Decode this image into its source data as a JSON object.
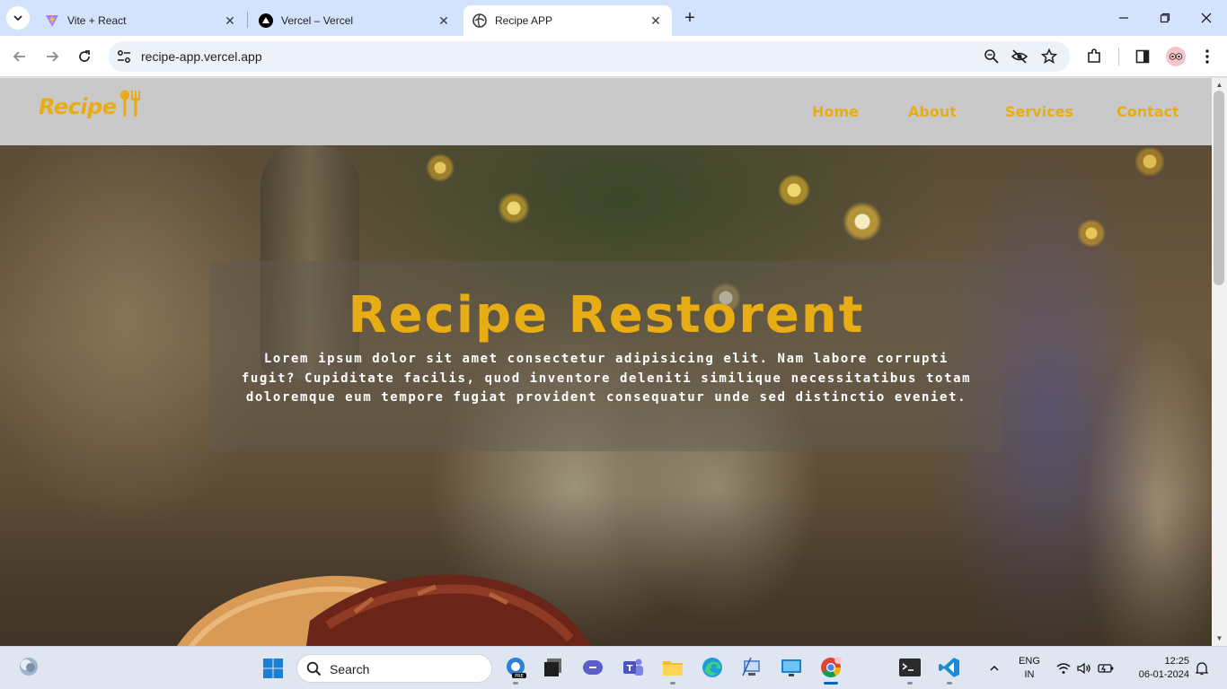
{
  "browser": {
    "tabs": [
      {
        "label": "Vite + React",
        "icon": "vite-icon",
        "active": false
      },
      {
        "label": "Vercel – Vercel",
        "icon": "vercel-icon",
        "active": false
      },
      {
        "label": "Recipe APP",
        "icon": "globe-icon",
        "active": true
      }
    ],
    "url": "recipe-app.vercel.app"
  },
  "site": {
    "logo": "Recipe",
    "nav": [
      "Home",
      "About",
      "Services",
      "Contact"
    ],
    "accent_color": "#e8ac14",
    "header_bg": "#c9c9c9"
  },
  "hero": {
    "title": "Recipe Restorent",
    "text": "Lorem ipsum dolor sit amet consectetur adipisicing elit. Nam labore corrupti fugit? Cupiditate facilis, quod inventore deleniti similique necessitatibus totam doloremque eum tempore fugiat provident consequatur unde sed distinctio eveniet."
  },
  "taskbar": {
    "search_placeholder": "Search",
    "language": "ENG",
    "region": "IN",
    "time": "12:25",
    "date": "06-01-2024"
  }
}
